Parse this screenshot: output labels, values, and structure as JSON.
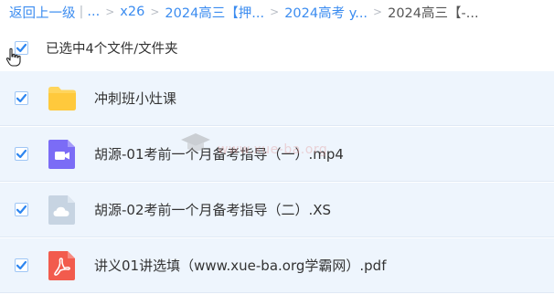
{
  "breadcrumb": {
    "back": "返回上一级",
    "ellipsis": "...",
    "items": [
      "x26",
      "2024高三【押...",
      "2024高考 y...",
      "2024高三【-..."
    ]
  },
  "selection": {
    "summary": "已选中4个文件/文件夹"
  },
  "files": [
    {
      "name": "冲刺班小灶课",
      "type": "folder",
      "checked": true
    },
    {
      "name": "胡源-01考前一个月备考指导（一）.mp4",
      "type": "video",
      "checked": true
    },
    {
      "name": "胡源-02考前一个月备考指导（二）.XS",
      "type": "cloud-file",
      "checked": true
    },
    {
      "name": "讲义01讲选填（www.xue-ba.org学霸网）.pdf",
      "type": "pdf",
      "checked": true
    }
  ],
  "watermark": {
    "text": "www.xue-ba.org"
  },
  "colors": {
    "link": "#3b8cf0",
    "row_bg": "#eef5fd",
    "check": "#2e86f0",
    "folder": "#ffd55c",
    "video": "#7b6cf6",
    "cloud": "#c7d4e2",
    "pdf": "#f25b4d"
  }
}
